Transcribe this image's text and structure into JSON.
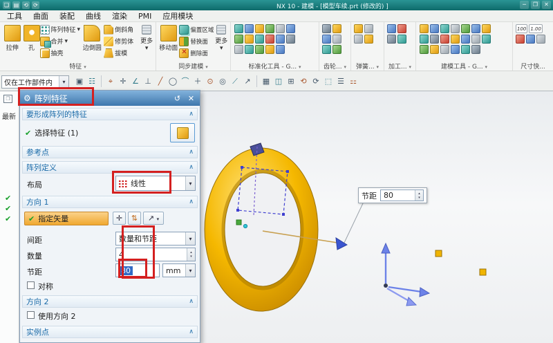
{
  "title_bar": {
    "title": "NX 10 - 建模 - [模型车续.prt (修改的) ]",
    "qat_icons": [
      "❏",
      "▤",
      "⟲",
      "⟳"
    ],
    "window_icons": {
      "min": "─",
      "max": "❐",
      "close": "✕"
    }
  },
  "menu": {
    "items": [
      "工具",
      "曲面",
      "装配",
      "曲线",
      "渲染",
      "PMI",
      "应用模块"
    ]
  },
  "ribbon": {
    "feature": {
      "label": "特征",
      "extrude": "拉伸",
      "hole": "孔",
      "pattern": "阵列特征",
      "unite": "合并",
      "shell": "抽壳",
      "edge_blend": "边倒圆",
      "chamfer": "倒斜角",
      "trim_body": "修剪体",
      "draft": "拔模",
      "more": "更多"
    },
    "sync": {
      "label": "同步建模",
      "move_face": "移动面",
      "offset_region": "偏置区域",
      "replace_face": "替换面",
      "delete_face": "删除面",
      "more": "更多"
    },
    "clusters": [
      {
        "label": "标准化工具 - G..."
      },
      {
        "label": "齿轮..."
      },
      {
        "label": "弹簧..."
      },
      {
        "label": "加工..."
      },
      {
        "label": "建模工具 - G..."
      },
      {
        "label": "尺寸快..."
      }
    ],
    "dim_icons": [
      "100",
      "1.00"
    ]
  },
  "selection_bar": {
    "scope": "仅在工作部件内",
    "icons": [
      "▣",
      "☷",
      "⌖",
      "✛",
      "∠",
      "⊥",
      "╱",
      "◯",
      "⌒",
      "＋",
      "⊙",
      "◎",
      "⟋",
      "↗",
      "▦",
      "◫",
      "⊞",
      "⟲",
      "⟳",
      "⬚",
      "☰",
      "⚏"
    ]
  },
  "navigator": {
    "latest": "最新"
  },
  "dialog": {
    "title": "阵列特征",
    "features_header": "要形成阵列的特征",
    "select_feature": "选择特征 (1)",
    "reference_header": "参考点",
    "definition_header": "阵列定义",
    "layout_label": "布局",
    "layout_value": "线性",
    "dir1_header": "方向 1",
    "vector_label": "指定矢量",
    "spacing_label": "间距",
    "spacing_value": "数量和节距",
    "count_label": "数量",
    "count_value": "4",
    "pitch_label": "节距",
    "pitch_value": "80",
    "unit_value": "mm",
    "symmetric_label": "对称",
    "dir2_header": "方向 2",
    "use_dir2_label": "使用方向 2",
    "instances_header": "实例点"
  },
  "viewport": {
    "pitch_label": "节距",
    "pitch_value": "80"
  },
  "icons": {
    "drop": "▾",
    "chev_up": "∧",
    "check": "✔",
    "gear": "⚙",
    "reset": "↺",
    "close": "✕",
    "spin_up": "▴",
    "spin_down": "▾",
    "vector_dialog": "✛",
    "reverse": "⇅",
    "vector_drop": "↗",
    "panel": "❒"
  },
  "colors": {
    "accent_red": "#d42020",
    "gold": "#f0b400",
    "highlight_orange": "#f0a830",
    "dialog_blue": "#1a6aa8",
    "titlebar_teal": "#0e6a6a"
  }
}
